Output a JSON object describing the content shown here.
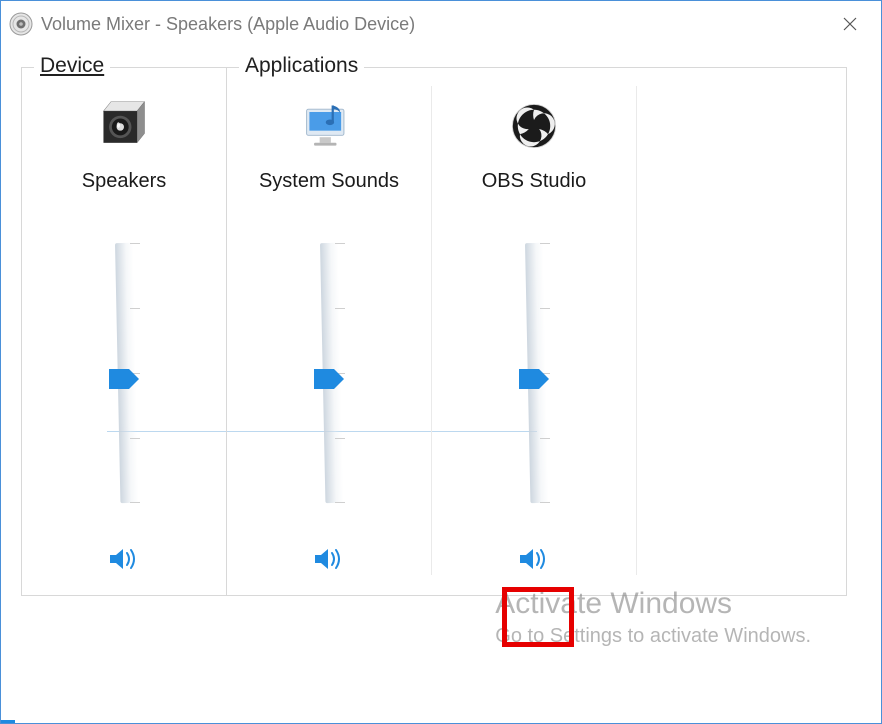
{
  "titlebar": {
    "title": "Volume Mixer - Speakers (Apple Audio Device)"
  },
  "panels": {
    "device_title": "Device",
    "apps_title": "Applications"
  },
  "device": {
    "label": "Speakers",
    "volume": 50
  },
  "apps": [
    {
      "label": "System Sounds",
      "volume": 50
    },
    {
      "label": "OBS Studio",
      "volume": 50
    }
  ],
  "watermark": {
    "line1": "Activate Windows",
    "line2": "Go to Settings to activate Windows."
  },
  "colors": {
    "accent": "#1f8ae0",
    "border": "#d8d8d8",
    "highlight_box": "#e60000"
  }
}
